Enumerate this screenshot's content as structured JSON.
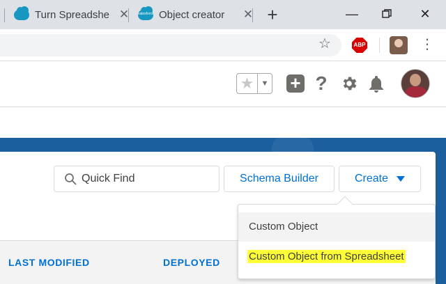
{
  "browser": {
    "tabs": [
      {
        "label": "Turn Spreadshe",
        "favicon": "salesforce-cloud-icon"
      },
      {
        "label": "Object creator",
        "favicon": "salesforce-cloud-icon",
        "favicon_text": "salesforce"
      }
    ],
    "new_tab_label": "+",
    "abp_label": "ABP"
  },
  "colors": {
    "brand_blue": "#0070d2",
    "banner_blue": "#1b5f9e",
    "highlight_yellow": "#ffff38",
    "tab_bar": "#dee1e6"
  },
  "sf_header": {
    "icons": [
      "favorite-star-icon",
      "global-actions-plus-icon",
      "help-icon",
      "setup-gear-icon",
      "notifications-bell-icon",
      "user-avatar"
    ]
  },
  "toolbar": {
    "search_placeholder": "Quick Find",
    "schema_builder_label": "Schema Builder",
    "create_label": "Create"
  },
  "create_menu": {
    "items": [
      {
        "label": "Custom Object",
        "hovered": true
      },
      {
        "label": "Custom Object from Spreadsheet",
        "highlighted": true
      }
    ]
  },
  "table": {
    "columns": [
      "LAST MODIFIED",
      "DEPLOYED"
    ]
  }
}
